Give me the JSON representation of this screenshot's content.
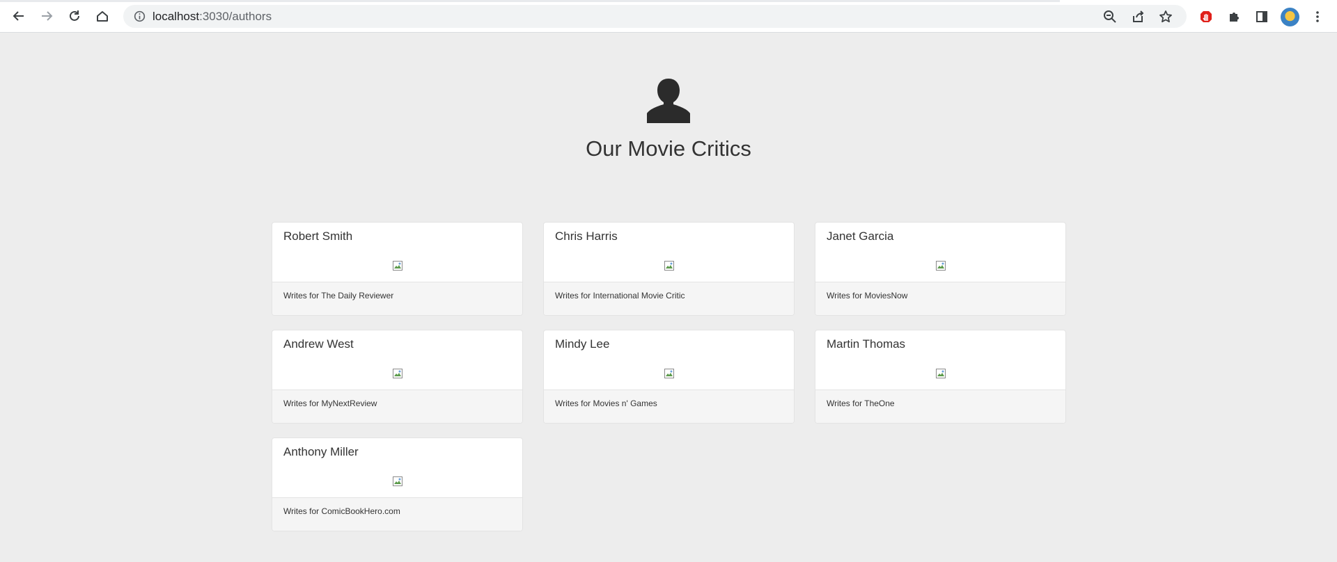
{
  "browser": {
    "url_host": "localhost",
    "url_path": ":3030/authors"
  },
  "page": {
    "title": "Our Movie Critics",
    "icons": {
      "hero": "user-icon",
      "broken_image": "broken-image-icon"
    }
  },
  "critics": [
    {
      "name": "Robert Smith",
      "publication": "Writes for The Daily Reviewer"
    },
    {
      "name": "Chris Harris",
      "publication": "Writes for International Movie Critic"
    },
    {
      "name": "Janet Garcia",
      "publication": "Writes for MoviesNow"
    },
    {
      "name": "Andrew West",
      "publication": "Writes for MyNextReview"
    },
    {
      "name": "Mindy Lee",
      "publication": "Writes for Movies n' Games"
    },
    {
      "name": "Martin Thomas",
      "publication": "Writes for TheOne"
    },
    {
      "name": "Anthony Miller",
      "publication": "Writes for ComicBookHero.com"
    }
  ]
}
